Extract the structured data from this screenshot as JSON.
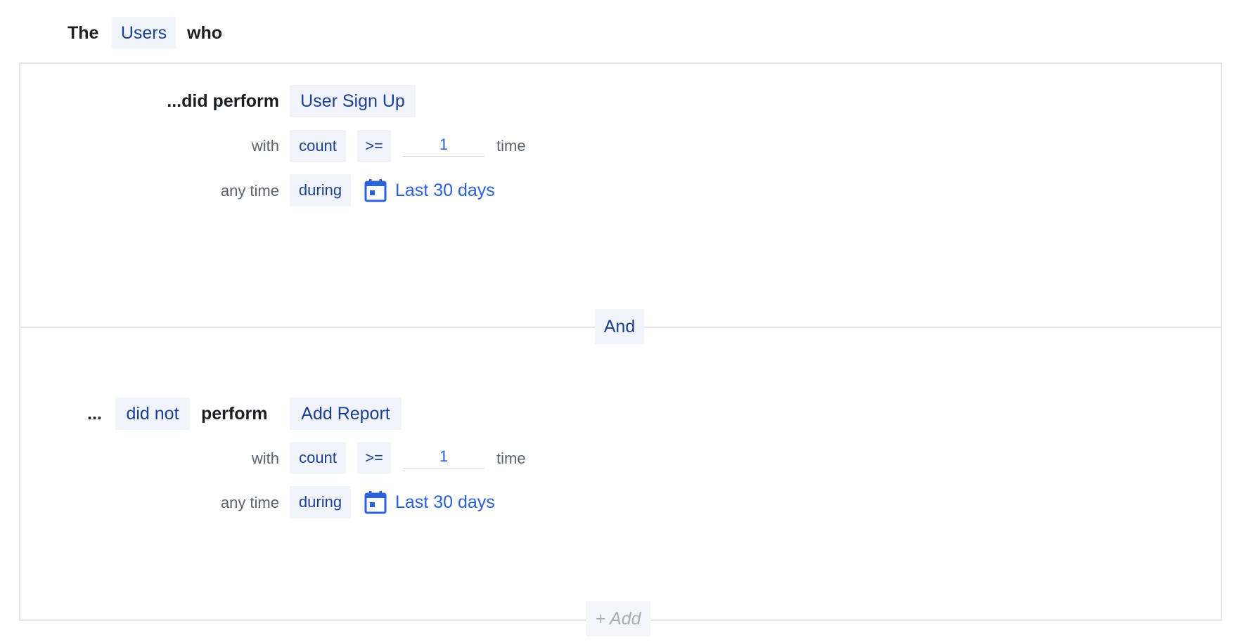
{
  "header": {
    "prefix": "The",
    "entity": "Users",
    "suffix": "who"
  },
  "conditions": [
    {
      "lead": "...did perform",
      "lead_ellipsis": "",
      "verb_modifier": "",
      "verb": "",
      "event": "User Sign Up",
      "with_label": "with",
      "metric": "count",
      "operator": ">=",
      "value": "1",
      "unit": "time",
      "time_label": "any time",
      "time_operator": "during",
      "date_range": "Last 30 days",
      "date_icon": "calendar-icon"
    },
    {
      "lead": "",
      "lead_ellipsis": "...",
      "verb_modifier": "did not",
      "verb": "perform",
      "event": "Add Report",
      "with_label": "with",
      "metric": "count",
      "operator": ">=",
      "value": "1",
      "unit": "time",
      "time_label": "any time",
      "time_operator": "during",
      "date_range": "Last 30 days",
      "date_icon": "calendar-icon"
    }
  ],
  "joiner": "And",
  "add_button": "+ Add",
  "colors": {
    "chip_bg": "#f1f5fb",
    "chip_text": "#1c3f96",
    "link_blue": "#2b61d9",
    "border": "#e1e4e8"
  }
}
